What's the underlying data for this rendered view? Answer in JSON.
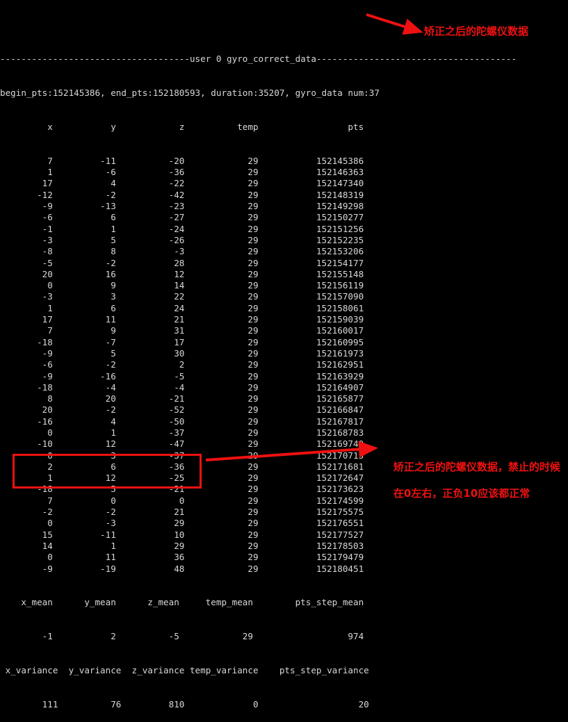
{
  "terminal": {
    "separator_char": "-",
    "header_line": "------------------------------------user 0 gyro_correct_data--------------------------------------",
    "session_line": "begin_pts:152145386, end_pts:152180593, duration:35207, gyro_data num:37",
    "columns": [
      "x",
      "y",
      "z",
      "temp",
      "pts"
    ],
    "column_header_line": "        x             y             z          temp               pts",
    "rows": [
      {
        "x": "7",
        "y": "-11",
        "z": "-20",
        "temp": "29",
        "pts": "152145386"
      },
      {
        "x": "1",
        "y": "-6",
        "z": "-36",
        "temp": "29",
        "pts": "152146363"
      },
      {
        "x": "17",
        "y": "4",
        "z": "-22",
        "temp": "29",
        "pts": "152147340"
      },
      {
        "x": "-12",
        "y": "-2",
        "z": "-42",
        "temp": "29",
        "pts": "152148319"
      },
      {
        "x": "-9",
        "y": "-13",
        "z": "-23",
        "temp": "29",
        "pts": "152149298"
      },
      {
        "x": "-6",
        "y": "6",
        "z": "-27",
        "temp": "29",
        "pts": "152150277"
      },
      {
        "x": "-1",
        "y": "1",
        "z": "-24",
        "temp": "29",
        "pts": "152151256"
      },
      {
        "x": "-3",
        "y": "5",
        "z": "-26",
        "temp": "29",
        "pts": "152152235"
      },
      {
        "x": "-8",
        "y": "8",
        "z": "-3",
        "temp": "29",
        "pts": "152153206"
      },
      {
        "x": "-5",
        "y": "-2",
        "z": "28",
        "temp": "29",
        "pts": "152154177"
      },
      {
        "x": "20",
        "y": "16",
        "z": "12",
        "temp": "29",
        "pts": "152155148"
      },
      {
        "x": "0",
        "y": "9",
        "z": "14",
        "temp": "29",
        "pts": "152156119"
      },
      {
        "x": "-3",
        "y": "3",
        "z": "22",
        "temp": "29",
        "pts": "152157090"
      },
      {
        "x": "1",
        "y": "6",
        "z": "24",
        "temp": "29",
        "pts": "152158061"
      },
      {
        "x": "17",
        "y": "11",
        "z": "21",
        "temp": "29",
        "pts": "152159039"
      },
      {
        "x": "7",
        "y": "9",
        "z": "31",
        "temp": "29",
        "pts": "152160017"
      },
      {
        "x": "-18",
        "y": "-7",
        "z": "17",
        "temp": "29",
        "pts": "152160995"
      },
      {
        "x": "-9",
        "y": "5",
        "z": "30",
        "temp": "29",
        "pts": "152161973"
      },
      {
        "x": "-6",
        "y": "-2",
        "z": "2",
        "temp": "29",
        "pts": "152162951"
      },
      {
        "x": "-9",
        "y": "-16",
        "z": "-5",
        "temp": "29",
        "pts": "152163929"
      },
      {
        "x": "-18",
        "y": "-4",
        "z": "-4",
        "temp": "29",
        "pts": "152164907"
      },
      {
        "x": "8",
        "y": "20",
        "z": "-21",
        "temp": "29",
        "pts": "152165877"
      },
      {
        "x": "20",
        "y": "-2",
        "z": "-52",
        "temp": "29",
        "pts": "152166847"
      },
      {
        "x": "-16",
        "y": "4",
        "z": "-50",
        "temp": "29",
        "pts": "152167817"
      },
      {
        "x": "0",
        "y": "1",
        "z": "-37",
        "temp": "29",
        "pts": "152168783"
      },
      {
        "x": "-10",
        "y": "12",
        "z": "-47",
        "temp": "29",
        "pts": "152169749"
      },
      {
        "x": "0",
        "y": "3",
        "z": "-37",
        "temp": "29",
        "pts": "152170715"
      },
      {
        "x": "2",
        "y": "6",
        "z": "-36",
        "temp": "29",
        "pts": "152171681"
      },
      {
        "x": "1",
        "y": "12",
        "z": "-25",
        "temp": "29",
        "pts": "152172647"
      },
      {
        "x": "-18",
        "y": "5",
        "z": "-21",
        "temp": "29",
        "pts": "152173623"
      },
      {
        "x": "7",
        "y": "0",
        "z": "0",
        "temp": "29",
        "pts": "152174599"
      },
      {
        "x": "-2",
        "y": "-2",
        "z": "21",
        "temp": "29",
        "pts": "152175575"
      },
      {
        "x": "0",
        "y": "-3",
        "z": "29",
        "temp": "29",
        "pts": "152176551"
      },
      {
        "x": "15",
        "y": "-11",
        "z": "10",
        "temp": "29",
        "pts": "152177527"
      },
      {
        "x": "14",
        "y": "1",
        "z": "29",
        "temp": "29",
        "pts": "152178503"
      },
      {
        "x": "0",
        "y": "11",
        "z": "36",
        "temp": "29",
        "pts": "152179479"
      },
      {
        "x": "-9",
        "y": "-19",
        "z": "48",
        "temp": "29",
        "pts": "152180451"
      }
    ],
    "mean_header": [
      "x_mean",
      "y_mean",
      "z_mean",
      "temp_mean",
      "pts_step_mean"
    ],
    "mean_values": [
      "-1",
      "2",
      "-5",
      "29",
      "974"
    ],
    "variance_header": [
      "x_variance",
      "y_variance",
      "z_variance",
      "temp_variance",
      "pts_step_variance"
    ],
    "variance_values": [
      "111",
      "76",
      "810",
      "0",
      "20"
    ],
    "session_label": "user 0 gyro_correct_data",
    "begin_pts": "152145386",
    "end_pts": "152180593",
    "duration": "35207",
    "gyro_data_num": "37"
  },
  "annotations": {
    "top": "矫正之后的陀螺仪数据",
    "bottom_line1": "矫正之后的陀螺仪数据，禁止的时候",
    "bottom_line2": "在0左右，正负10应该都正常",
    "accent_color": "#ee1111",
    "text_color": "#d8d8d8",
    "background_color": "#000000"
  }
}
